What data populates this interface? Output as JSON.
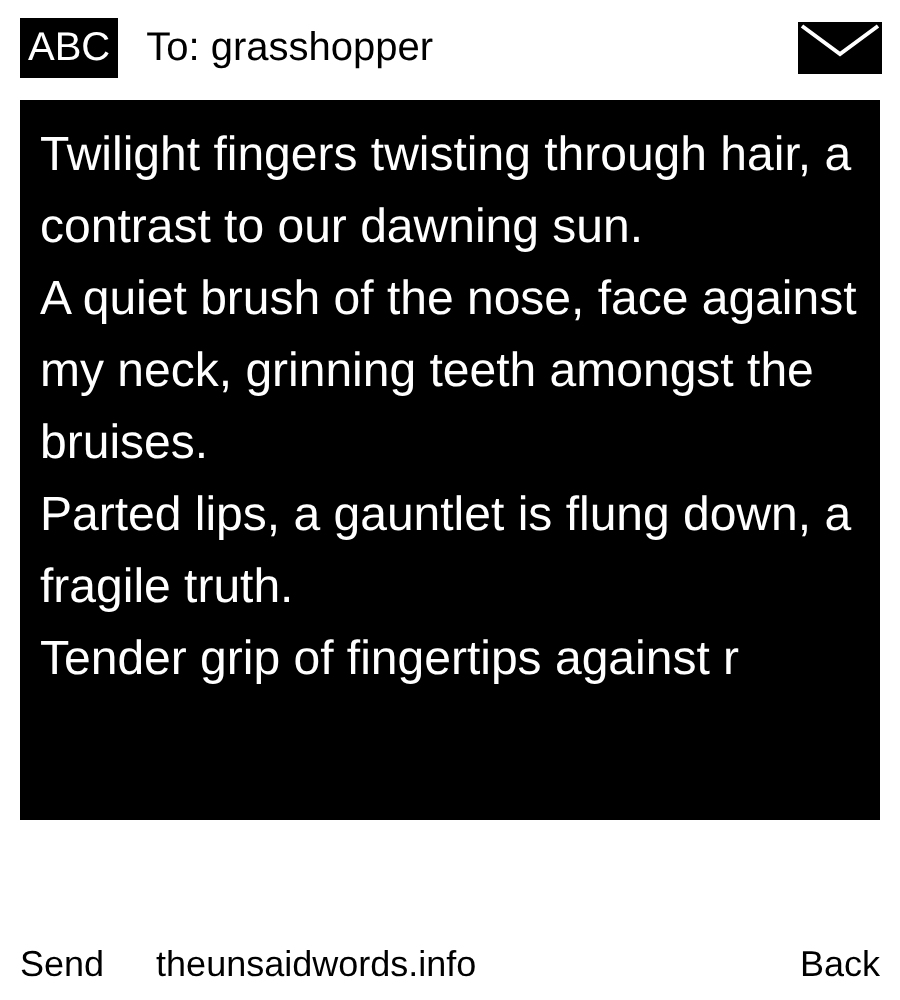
{
  "header": {
    "mode": "ABC",
    "recipient": "To: grasshopper"
  },
  "message": {
    "paragraphs": [
      "Twilight fingers twisting through hair, a contrast to our dawning sun.",
      "A quiet brush of the nose, face against my neck, grinning teeth amongst the bruises.",
      "Parted lips, a gauntlet is flung down, a fragile truth.",
      "Tender grip of fingertips against r"
    ]
  },
  "softkeys": {
    "left": "Send",
    "center": "theunsaidwords.info",
    "right": "Back"
  }
}
